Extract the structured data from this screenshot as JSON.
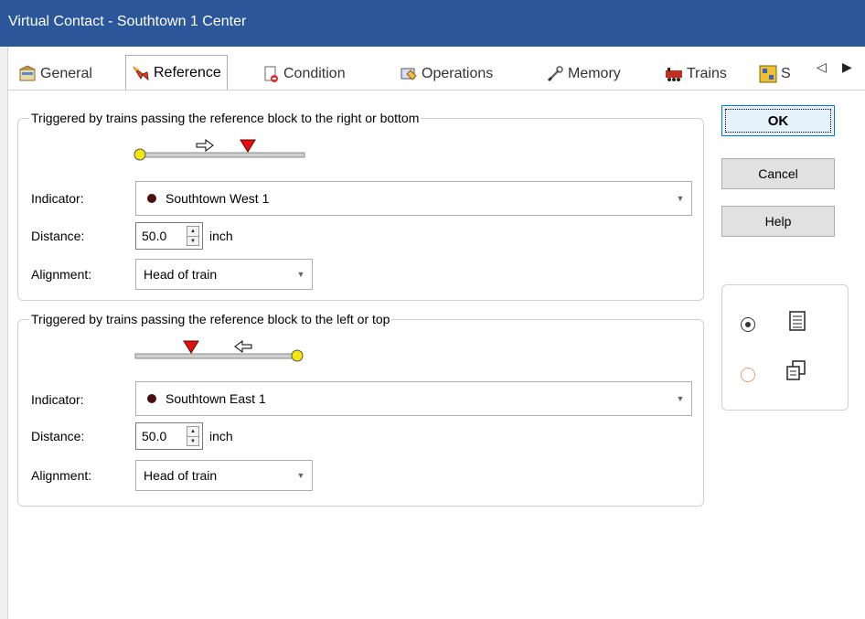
{
  "window": {
    "title": "Virtual Contact - Southtown 1 Center"
  },
  "tabs": [
    {
      "label": "General",
      "icon": "general-icon"
    },
    {
      "label": "Reference",
      "icon": "reference-icon",
      "active": true
    },
    {
      "label": "Condition",
      "icon": "condition-icon"
    },
    {
      "label": "Operations",
      "icon": "operations-icon"
    },
    {
      "label": "Memory",
      "icon": "memory-icon"
    },
    {
      "label": "Trains",
      "icon": "trains-icon"
    },
    {
      "label": "S",
      "icon": "s-icon"
    }
  ],
  "groups": {
    "right": {
      "legend": "Triggered by trains passing the reference block to the right or bottom",
      "indicator_label": "Indicator:",
      "indicator_value": "Southtown West 1",
      "distance_label": "Distance:",
      "distance_value": "50.0",
      "distance_unit": "inch",
      "alignment_label": "Alignment:",
      "alignment_value": "Head of train"
    },
    "left": {
      "legend": "Triggered by trains passing the reference block to the left or top",
      "indicator_label": "Indicator:",
      "indicator_value": "Southtown East 1",
      "distance_label": "Distance:",
      "distance_value": "50.0",
      "distance_unit": "inch",
      "alignment_label": "Alignment:",
      "alignment_value": "Head of train"
    }
  },
  "buttons": {
    "ok": "OK",
    "cancel": "Cancel",
    "help": "Help"
  },
  "colors": {
    "titlebar": "#2b579a",
    "marker": "#e01010",
    "endpoint": "#f5e60a",
    "indicator_dot": "#4a1010"
  },
  "view_options": [
    {
      "icon": "list-view-icon",
      "selected": true
    },
    {
      "icon": "pages-view-icon",
      "selected": false
    }
  ]
}
